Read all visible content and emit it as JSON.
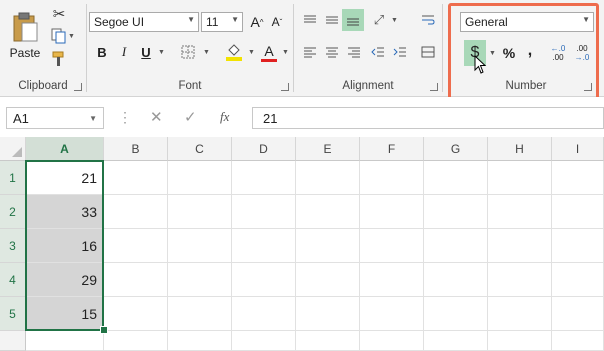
{
  "ribbon": {
    "clipboard": {
      "paste_label": "Paste",
      "group_label": "Clipboard"
    },
    "font": {
      "font_name": "Segoe UI",
      "font_size": "11",
      "bold": "B",
      "italic": "I",
      "underline": "U",
      "font_color_letter": "A",
      "grow": "A",
      "shrink": "A",
      "group_label": "Font"
    },
    "alignment": {
      "group_label": "Alignment"
    },
    "number": {
      "format_value": "General",
      "currency_symbol": "$",
      "percent_symbol": "%",
      "comma_symbol": ",",
      "inc_decimal_top": "←.0",
      "inc_decimal_bottom": ".00",
      "dec_decimal_top": ".00",
      "dec_decimal_bottom": "→.0",
      "group_label": "Number",
      "highlight_color": "#ee6c4d"
    }
  },
  "formula_bar": {
    "name_box": "A1",
    "fx_label": "fx",
    "formula": "21"
  },
  "sheet": {
    "columns": [
      "A",
      "B",
      "C",
      "D",
      "E",
      "F",
      "G",
      "H",
      "I"
    ],
    "rows": [
      "1",
      "2",
      "3",
      "4",
      "5"
    ],
    "values": [
      "21",
      "33",
      "16",
      "29",
      "15"
    ],
    "accent_color": "#217346"
  }
}
